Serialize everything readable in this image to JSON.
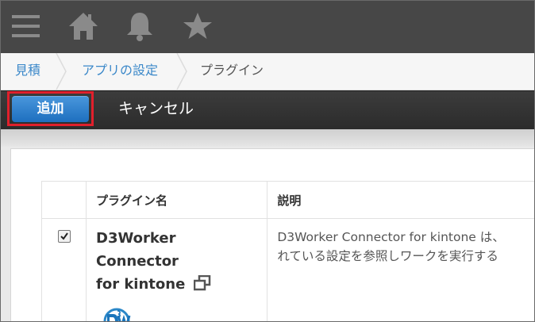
{
  "header": {
    "icons": [
      "menu-icon",
      "home-icon",
      "bell-icon",
      "star-icon"
    ]
  },
  "breadcrumb": {
    "items": [
      "見積",
      "アプリの設定",
      "プラグイン"
    ]
  },
  "actions": {
    "add_label": "追加",
    "cancel_label": "キャンセル"
  },
  "table": {
    "headers": [
      "",
      "プラグイン名",
      "説明"
    ],
    "rows": [
      {
        "checked": true,
        "name_line1": "D3Worker Connector",
        "name_line2": "for kintone",
        "description_line1": "D3Worker Connector for kintone は、",
        "description_line2": "れている設定を参照しワークを実行する"
      }
    ]
  },
  "colors": {
    "header_bg": "#474747",
    "link": "#3b88c9",
    "primary_button": "#1d6fbf",
    "highlight": "#e0202c"
  }
}
